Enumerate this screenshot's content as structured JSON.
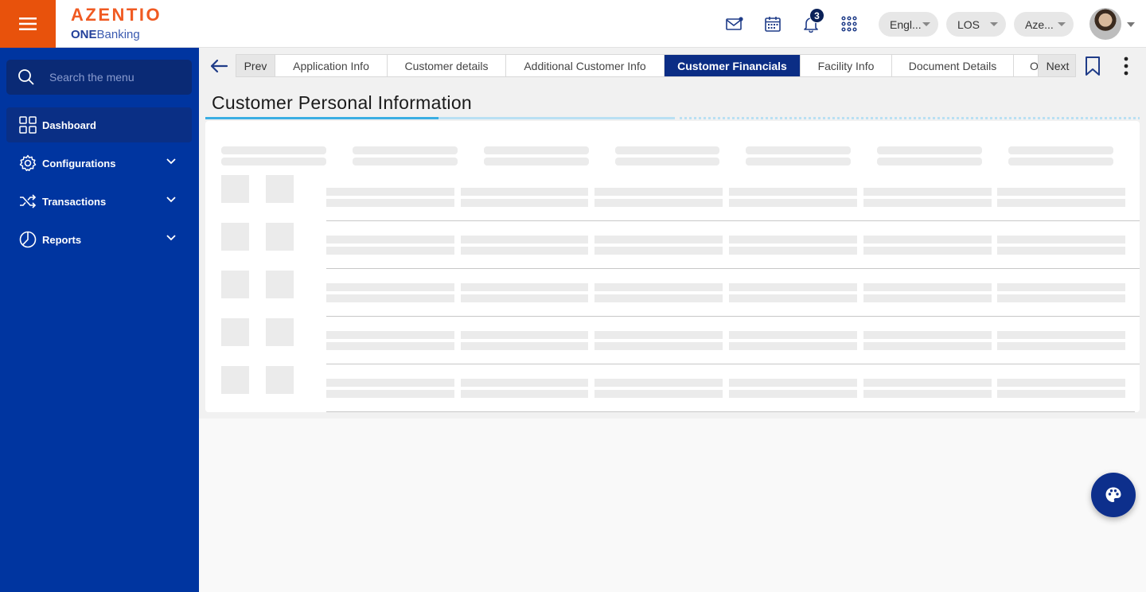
{
  "header": {
    "logo_main": "AZENTIO",
    "logo_sub_bold": "ONE",
    "logo_sub_rest": "Banking",
    "notification_count": "3",
    "language": "Engl...",
    "module": "LOS",
    "entity": "Aze...",
    "icons": [
      "mail-icon",
      "calendar-icon",
      "bell-icon",
      "apps-grid-icon"
    ]
  },
  "sidebar": {
    "search_placeholder": "Search the menu",
    "items": [
      {
        "label": "Dashboard",
        "icon": "dashboard-grid-icon",
        "active": true
      },
      {
        "label": "Configurations",
        "icon": "gear-icon",
        "expandable": true
      },
      {
        "label": "Transactions",
        "icon": "shuffle-icon",
        "expandable": true
      },
      {
        "label": "Reports",
        "icon": "pie-chart-icon",
        "expandable": true
      }
    ]
  },
  "tabs": {
    "prev": "Prev",
    "next": "Next",
    "items": [
      {
        "label": "Application Info"
      },
      {
        "label": "Customer details"
      },
      {
        "label": "Additional Customer Info"
      },
      {
        "label": "Customer Financials",
        "active": true
      },
      {
        "label": "Facility Info"
      },
      {
        "label": "Document Details"
      },
      {
        "label": "O"
      }
    ]
  },
  "page": {
    "title": "Customer Personal Information"
  },
  "colors": {
    "brand_orange": "#e8520c",
    "sidebar_blue": "#0035a0",
    "active_tab": "#0b2d85",
    "progress_blue": "#3aaee3"
  }
}
